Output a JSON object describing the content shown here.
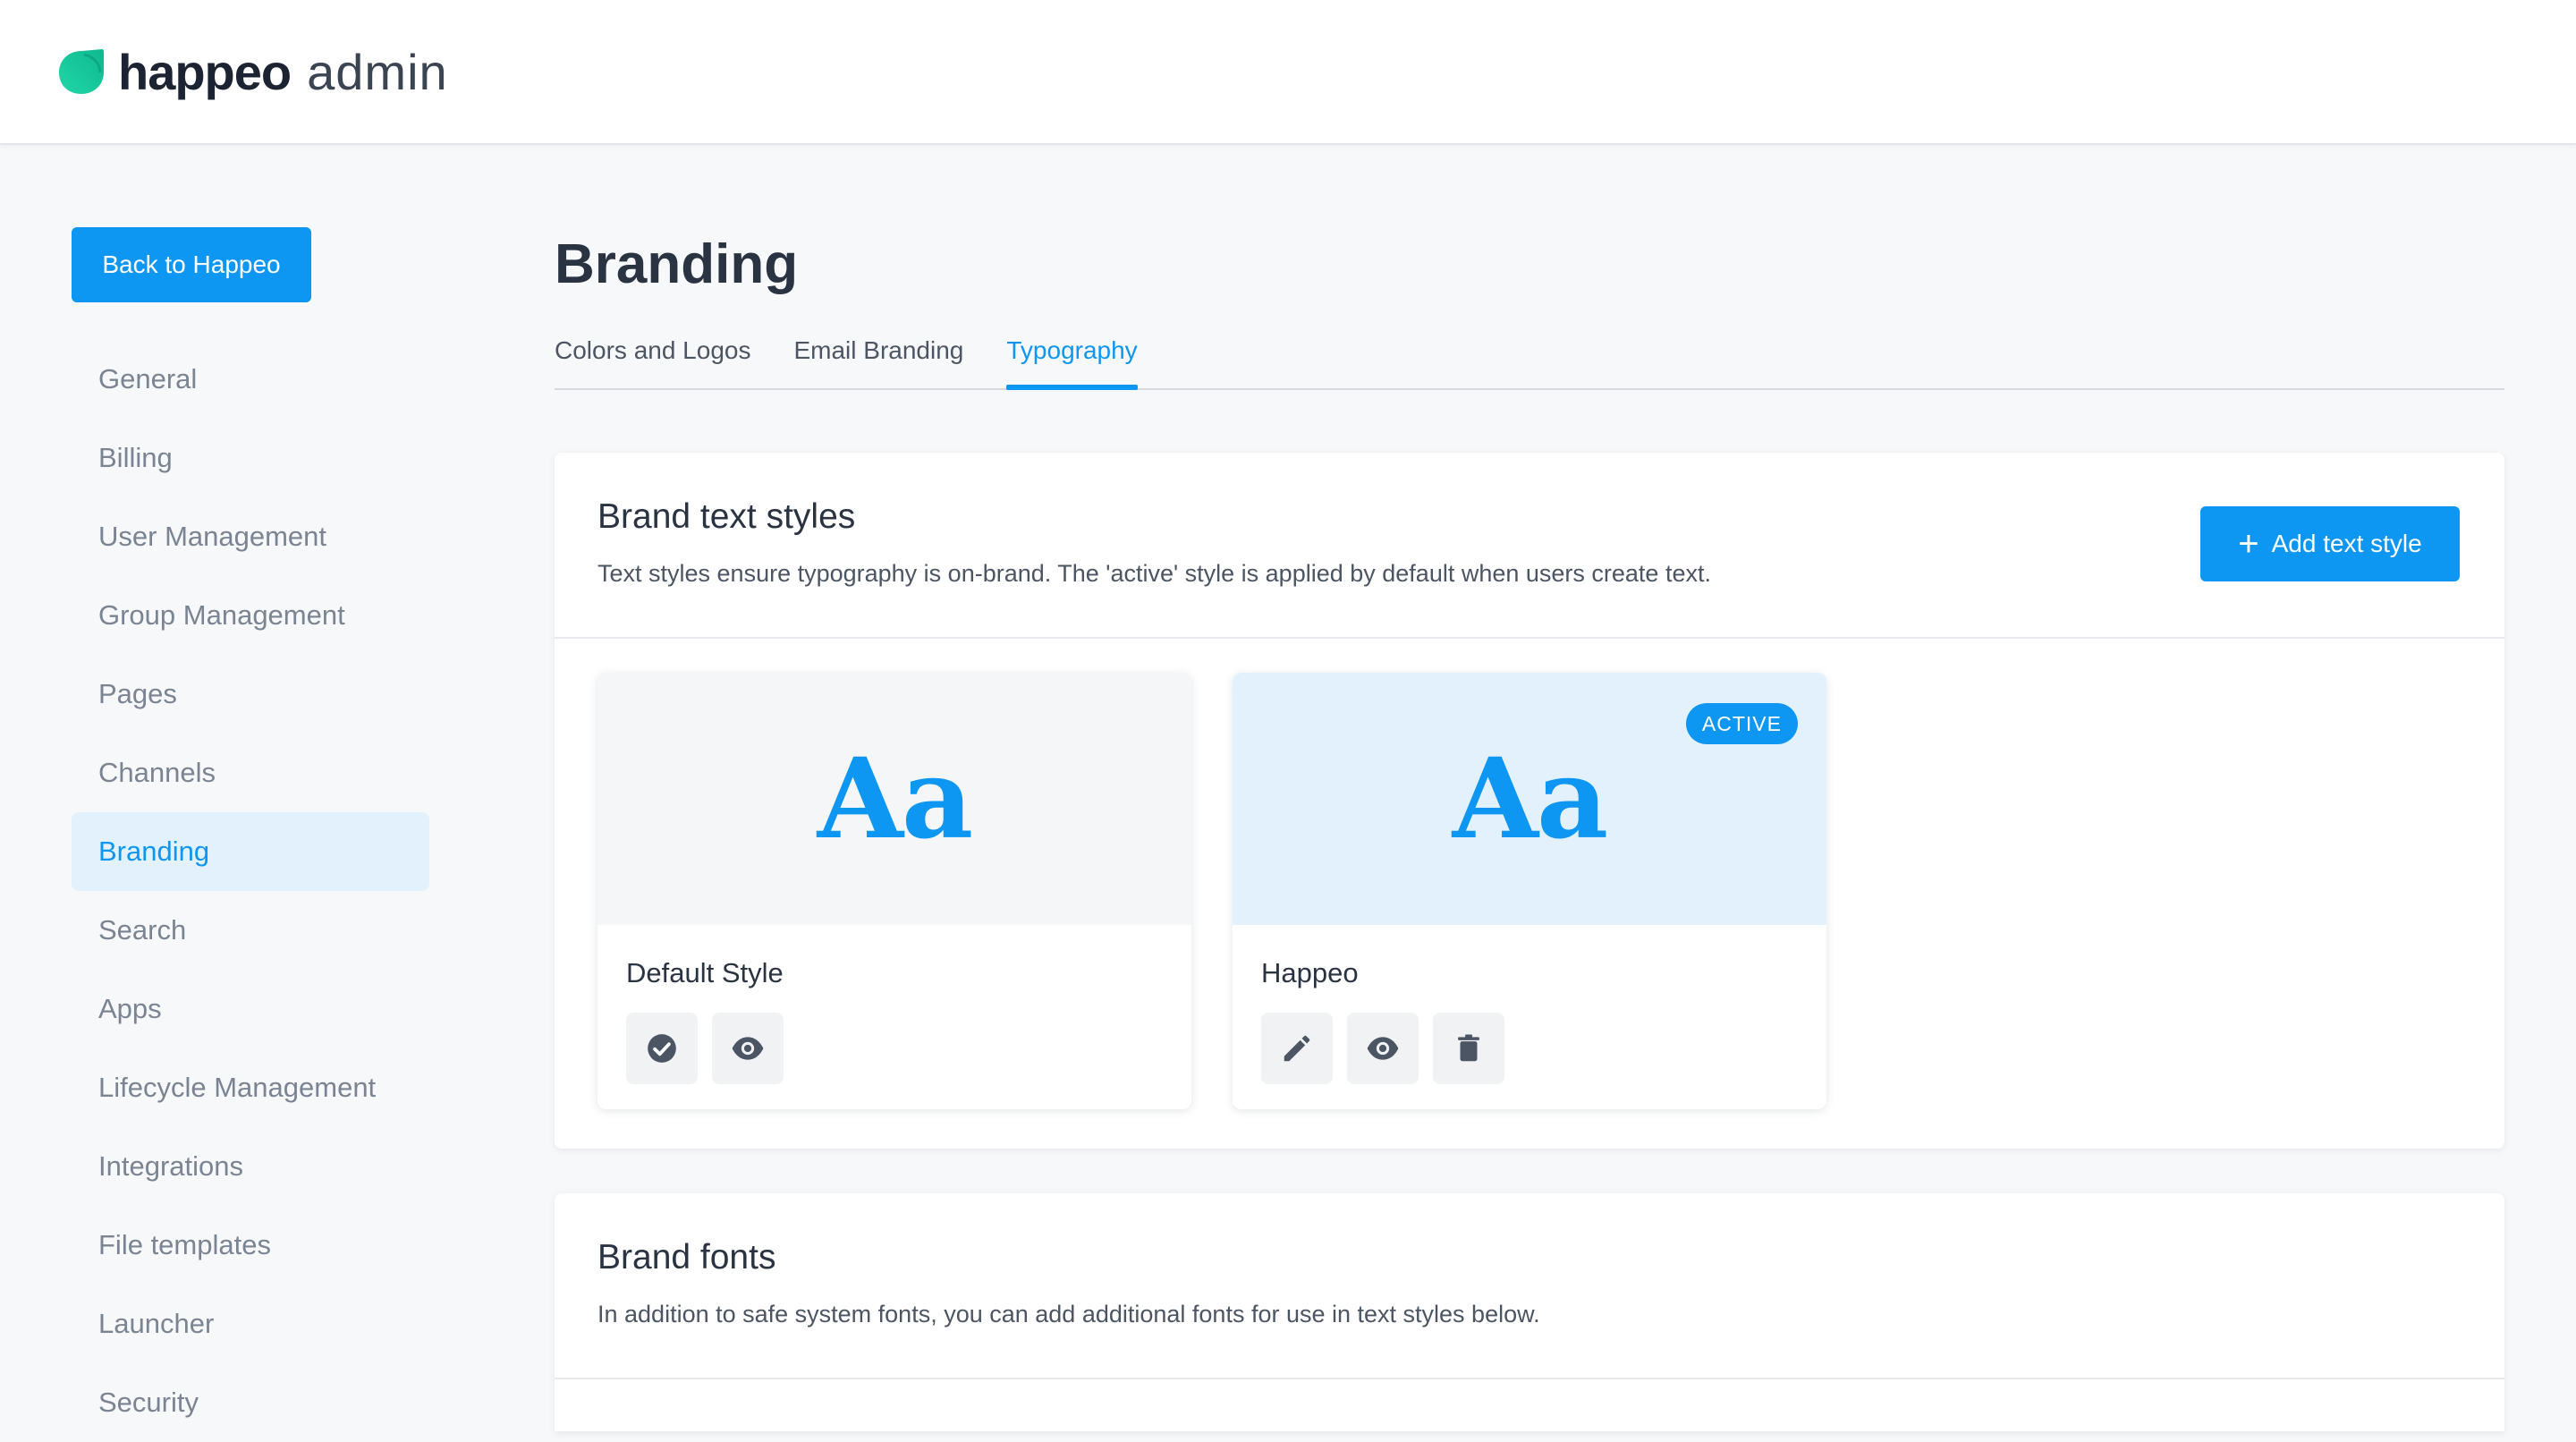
{
  "header": {
    "logo_word": "happeo",
    "logo_suffix": "admin"
  },
  "sidebar": {
    "back_label": "Back to Happeo",
    "items": [
      {
        "label": "General",
        "active": false
      },
      {
        "label": "Billing",
        "active": false
      },
      {
        "label": "User Management",
        "active": false
      },
      {
        "label": "Group Management",
        "active": false
      },
      {
        "label": "Pages",
        "active": false
      },
      {
        "label": "Channels",
        "active": false
      },
      {
        "label": "Branding",
        "active": true
      },
      {
        "label": "Search",
        "active": false
      },
      {
        "label": "Apps",
        "active": false
      },
      {
        "label": "Lifecycle Management",
        "active": false
      },
      {
        "label": "Integrations",
        "active": false
      },
      {
        "label": "File templates",
        "active": false
      },
      {
        "label": "Launcher",
        "active": false
      },
      {
        "label": "Security",
        "active": false
      }
    ]
  },
  "main": {
    "title": "Branding",
    "tabs": [
      {
        "label": "Colors and Logos",
        "active": false
      },
      {
        "label": "Email Branding",
        "active": false
      },
      {
        "label": "Typography",
        "active": true
      }
    ]
  },
  "text_styles": {
    "title": "Brand text styles",
    "description": "Text styles ensure typography is on-brand. The 'active' style is applied by default when users create text.",
    "add_label": "Add text style",
    "preview_glyph": "Aa",
    "active_badge": "ACTIVE",
    "cards": [
      {
        "name": "Default Style",
        "active": false,
        "actions": [
          "check-circle-icon",
          "eye-icon"
        ]
      },
      {
        "name": "Happeo",
        "active": true,
        "actions": [
          "pencil-icon",
          "eye-icon",
          "trash-icon"
        ]
      }
    ]
  },
  "fonts": {
    "title": "Brand fonts",
    "description": "In addition to safe system fonts, you can add additional fonts for use in text styles below."
  },
  "colors": {
    "accent": "#0d96f2",
    "accent_light": "#e3f1fd",
    "logo_green": "#17c9a0"
  }
}
